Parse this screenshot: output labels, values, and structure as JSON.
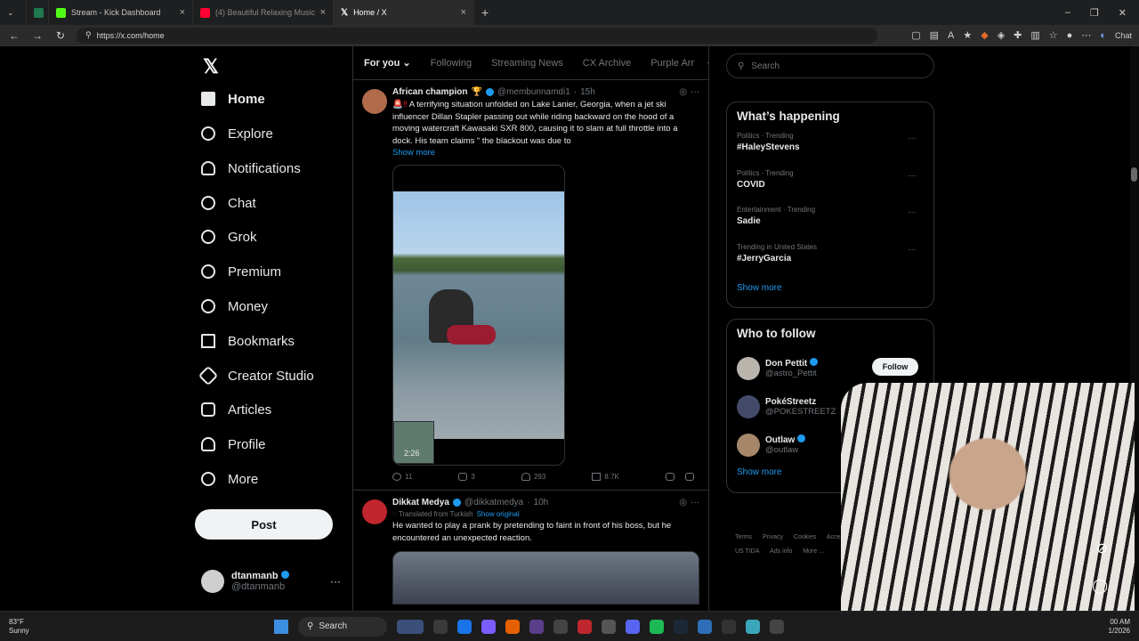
{
  "browser": {
    "tabs": [
      {
        "label": "Stream - Kick Dashboard",
        "color": "#53fc18"
      },
      {
        "label": "(4) Beautiful Relaxing Music - Stop",
        "color": "#ff0033"
      },
      {
        "label": "Home / X",
        "color": "#ffffff"
      }
    ],
    "url": "https://x.com/home",
    "chat_label": "Chat"
  },
  "nav": {
    "items": [
      {
        "label": "Home",
        "icon": "home-icon"
      },
      {
        "label": "Explore",
        "icon": "search-icon"
      },
      {
        "label": "Notifications",
        "icon": "bell-icon"
      },
      {
        "label": "Chat",
        "icon": "chat-icon"
      },
      {
        "label": "Grok",
        "icon": "grok-icon"
      },
      {
        "label": "Premium",
        "icon": "premium-icon"
      },
      {
        "label": "Money",
        "icon": "money-icon"
      },
      {
        "label": "Bookmarks",
        "icon": "bookmark-icon"
      },
      {
        "label": "Creator Studio",
        "icon": "rocket-icon"
      },
      {
        "label": "Articles",
        "icon": "articles-icon"
      },
      {
        "label": "Profile",
        "icon": "person-icon"
      },
      {
        "label": "More",
        "icon": "more-icon"
      }
    ],
    "post_label": "Post",
    "me": {
      "name": "dtanmanb",
      "handle": "@dtanmanb"
    }
  },
  "feed": {
    "tabs": [
      "For you",
      "Following",
      "Streaming News",
      "CX Archive",
      "Purple Arr"
    ],
    "tweet1": {
      "name": "African champion",
      "handle": "@membunnamdi1",
      "time": "15h",
      "text": "A terrifying situation unfolded on Lake Lanier, Georgia, when a jet ski influencer Dillan Stapler passing out while riding backward on the hood of a moving watercraft Kawasaki SXR 800, causing it to slam at full throttle into a dock. His team claims “ the blackout was due to",
      "show_more": "Show more",
      "duration": "2:26",
      "replies": "11",
      "reposts": "3",
      "likes": "293",
      "views": "8.7K"
    },
    "tweet2": {
      "name": "Dikkat Medya",
      "handle": "@dikkatmedya",
      "time": "10h",
      "translated": "Translated from Turkish",
      "show_original": "Show original",
      "text": "He wanted to play a prank by pretending to faint in front of his boss, but he encountered an unexpected reaction."
    }
  },
  "sidebar": {
    "search_placeholder": "Search",
    "happening_title": "What’s happening",
    "trends": [
      {
        "category": "Politics · Trending",
        "topic": "#HaleyStevens"
      },
      {
        "category": "Politics · Trending",
        "topic": "COVID"
      },
      {
        "category": "Entertainment · Trending",
        "topic": "Sadie"
      },
      {
        "category": "Trending in United States",
        "topic": "#JerryGarcia"
      }
    ],
    "show_more": "Show more",
    "who_title": "Who to follow",
    "who": [
      {
        "name": "Don Pettit",
        "handle": "@astro_Pettit"
      },
      {
        "name": "PokéStreetz",
        "handle": "@POKESTREETZ"
      },
      {
        "name": "Outlaw",
        "handle": "@outlaw"
      }
    ],
    "follow_label": "Follow",
    "footer": [
      "Terms",
      "Privacy",
      "Cookies",
      "Access",
      "US TIDA",
      "Ads info",
      "More ..."
    ]
  },
  "taskbar": {
    "temp": "83°F",
    "condition": "Sunny",
    "search": "Search",
    "time": "00 AM",
    "date": "1/2026"
  }
}
